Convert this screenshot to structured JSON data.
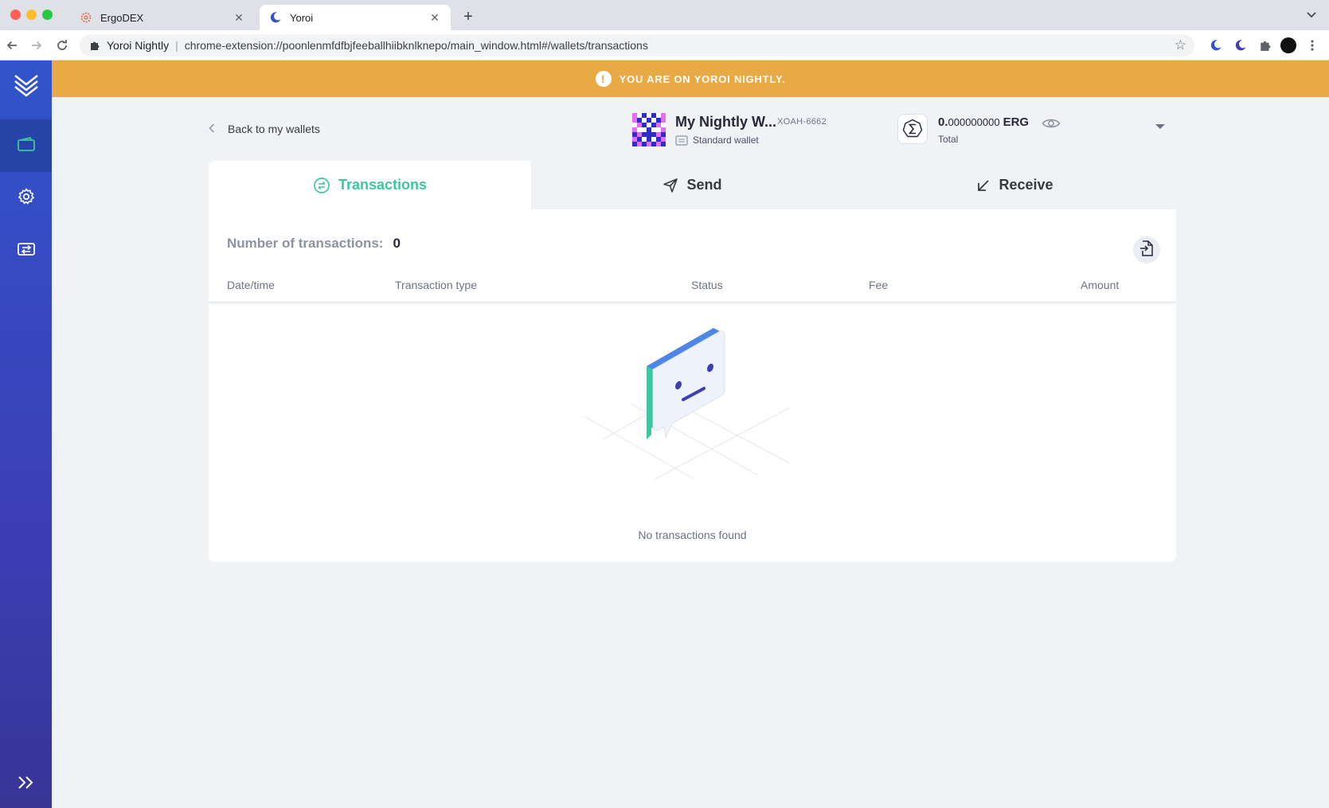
{
  "browser": {
    "tabs": [
      {
        "title": "ErgoDEX",
        "active": false
      },
      {
        "title": "Yoroi",
        "active": true
      }
    ],
    "site_name": "Yoroi Nightly",
    "url": "chrome-extension://poonlenmfdfbjfeeballhiibknlknepo/main_window.html#/wallets/transactions"
  },
  "banner": {
    "text": "YOU ARE ON YOROI NIGHTLY.",
    "color": "#e9a944"
  },
  "sidebar": {
    "items": [
      {
        "icon": "wallet-icon",
        "active": true
      },
      {
        "icon": "settings-icon",
        "active": false
      },
      {
        "icon": "transfer-icon",
        "active": false
      }
    ],
    "colors": {
      "top": "#3154cb",
      "bottom": "#383596"
    }
  },
  "wallet": {
    "back_label": "Back to my wallets",
    "name": "My Nightly W...",
    "plate": "XOAH-6662",
    "type": "Standard wallet",
    "balance_int": "0.",
    "balance_dec": "000000000",
    "currency": "ERG",
    "total_label": "Total"
  },
  "tabs": {
    "transactions": "Transactions",
    "send": "Send",
    "receive": "Receive",
    "accent": "#3ec6a0"
  },
  "transactions": {
    "count_label": "Number of transactions:",
    "count": "0",
    "columns": [
      "Date/time",
      "Transaction type",
      "Status",
      "Fee",
      "Amount"
    ],
    "empty_text": "No transactions found"
  }
}
